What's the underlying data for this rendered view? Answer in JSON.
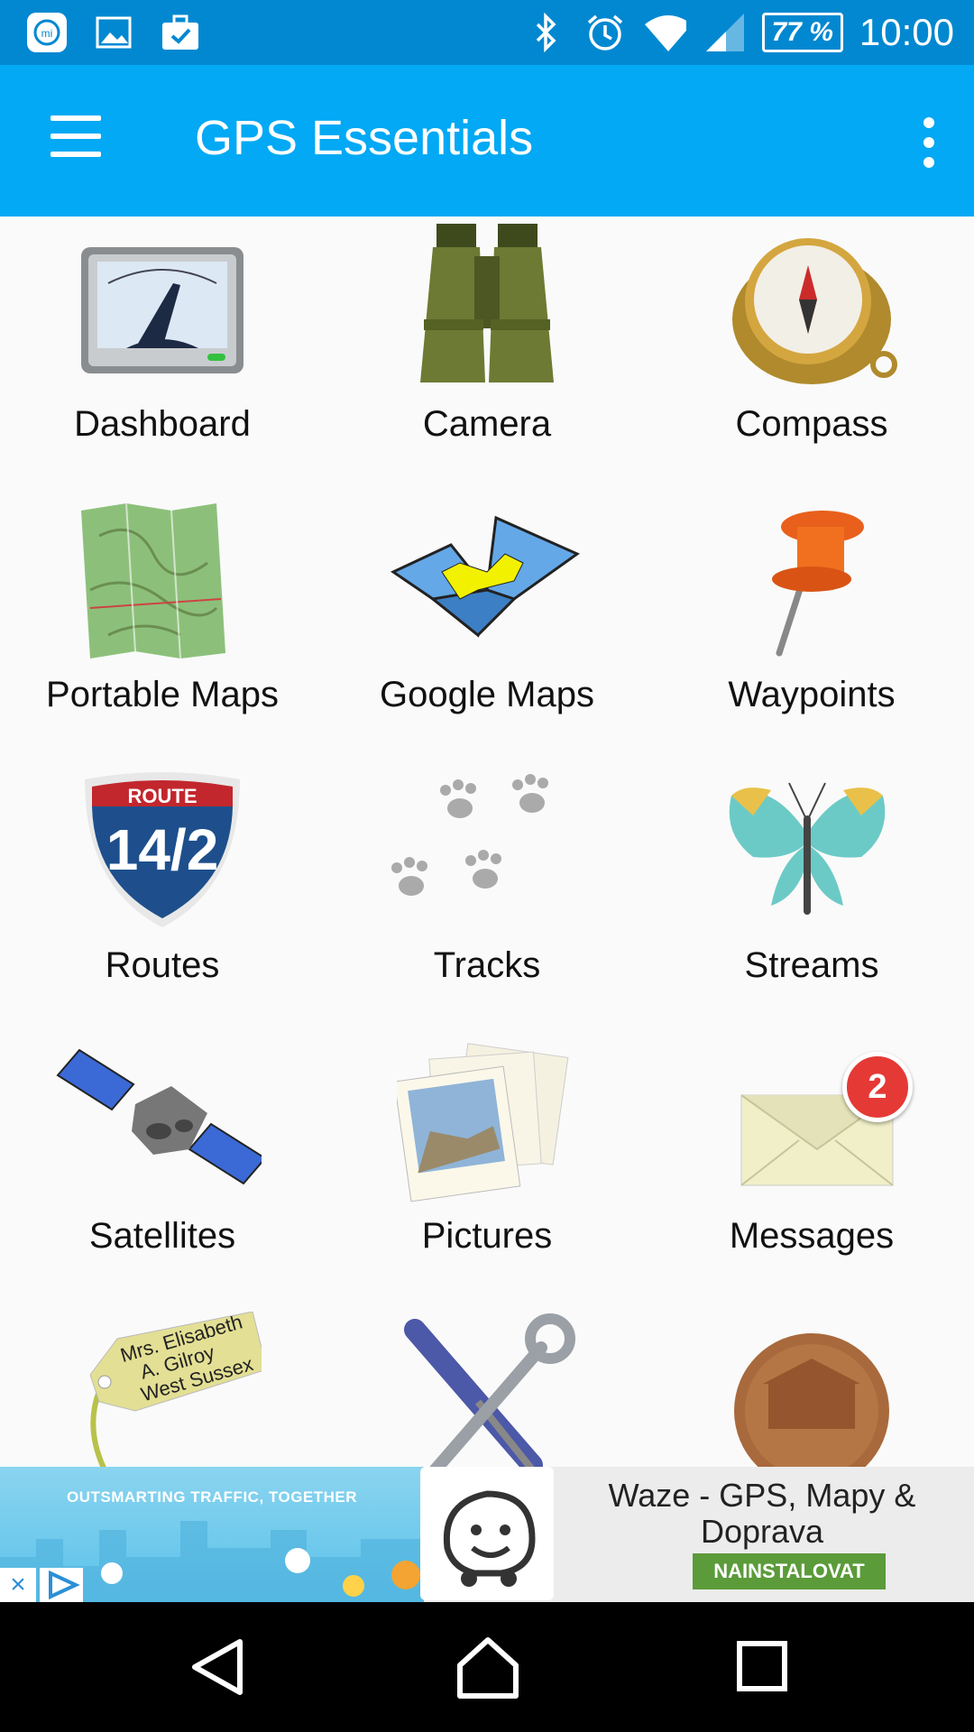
{
  "status_bar": {
    "battery": "77 %",
    "time": "10:00",
    "left_icons": [
      "mi-icon",
      "image-icon",
      "briefcase-check-icon"
    ],
    "right_icons": [
      "bluetooth-icon",
      "alarm-icon",
      "wifi-icon",
      "signal-icon"
    ]
  },
  "app_bar": {
    "title": "GPS Essentials",
    "menu_icon": "hamburger-menu-icon",
    "overflow_icon": "more-vertical-icon",
    "color": "#03a9f4"
  },
  "grid": {
    "items": [
      {
        "label": "Dashboard",
        "icon": "speedometer-gauge-icon"
      },
      {
        "label": "Camera",
        "icon": "binoculars-icon"
      },
      {
        "label": "Compass",
        "icon": "compass-icon"
      },
      {
        "label": "Portable Maps",
        "icon": "topographic-map-icon"
      },
      {
        "label": "Google Maps",
        "icon": "folded-map-icon"
      },
      {
        "label": "Waypoints",
        "icon": "pushpin-icon"
      },
      {
        "label": "Routes",
        "icon": "route-shield-icon"
      },
      {
        "label": "Tracks",
        "icon": "paw-prints-icon"
      },
      {
        "label": "Streams",
        "icon": "butterfly-icon"
      },
      {
        "label": "Satellites",
        "icon": "satellite-icon"
      },
      {
        "label": "Pictures",
        "icon": "photos-icon"
      },
      {
        "label": "Messages",
        "icon": "envelope-icon"
      },
      {
        "label": "",
        "icon": "address-tag-icon"
      },
      {
        "label": "",
        "icon": "tools-icon"
      },
      {
        "label": "",
        "icon": "penny-coin-icon"
      }
    ],
    "messages_badge": "2",
    "route_shield": {
      "top": "ROUTE",
      "number": "14/2"
    },
    "tag_text": [
      "Mrs. Elisabeth",
      "A. Gilroy",
      "West Sussex"
    ]
  },
  "ad": {
    "tagline": "OUTSMARTING TRAFFIC, TOGETHER",
    "title": "Waze - GPS, Mapy & Doprava",
    "install": "NAINSTALOVAT",
    "close": "×"
  },
  "nav_bar": {
    "icons": [
      "back-icon",
      "home-icon",
      "recents-icon"
    ]
  }
}
